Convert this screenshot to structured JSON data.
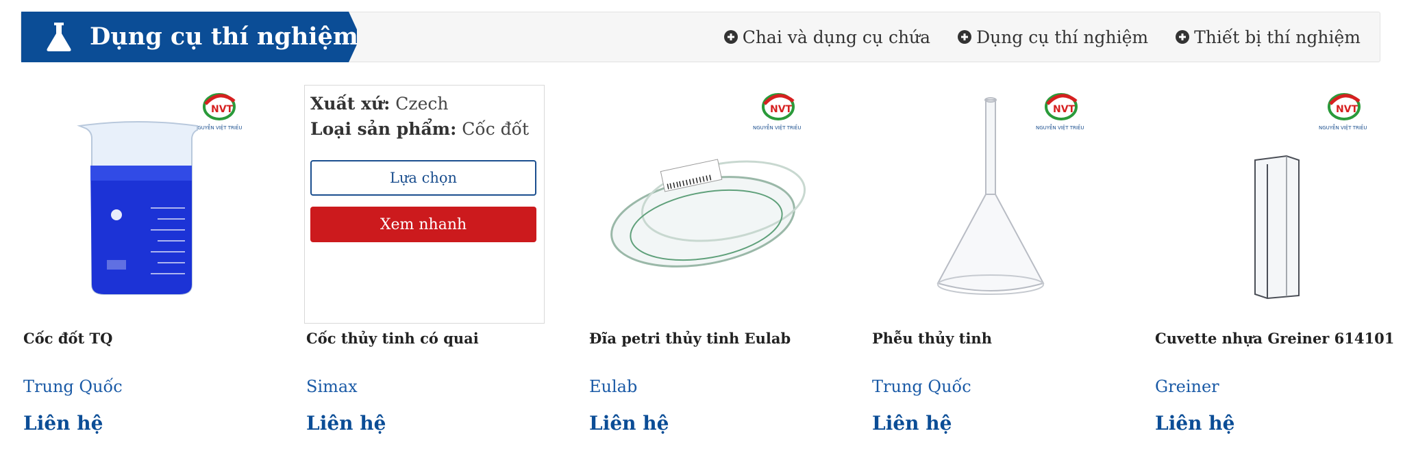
{
  "category": {
    "title": "Dụng cụ thí nghiệm",
    "links": [
      {
        "label": "Chai và dụng cụ chứa",
        "icon": "plus-circle-icon"
      },
      {
        "label": "Dụng cụ thí nghiệm",
        "icon": "plus-circle-icon"
      },
      {
        "label": "Thiết bị thí nghiệm",
        "icon": "plus-circle-icon"
      }
    ]
  },
  "logo": {
    "mark": "NVT",
    "text": "NGUYỄN VIỆT TRIỀU"
  },
  "products": [
    {
      "name": "Cốc đốt TQ",
      "brand": "Trung Quốc",
      "price": "Liên hệ",
      "image": "blue-beaker"
    },
    {
      "name": "Cốc thủy tinh có quai",
      "brand": "Simax",
      "price": "Liên hệ",
      "image": "hover-panel"
    },
    {
      "name": "Đĩa petri thủy tinh Eulab",
      "brand": "Eulab",
      "price": "Liên hệ",
      "image": "petri-dish"
    },
    {
      "name": "Phễu thủy tinh",
      "brand": "Trung Quốc",
      "price": "Liên hệ",
      "image": "glass-funnel"
    },
    {
      "name": "Cuvette nhựa Greiner 614101",
      "brand": "Greiner",
      "price": "Liên hệ",
      "image": "cuvette"
    }
  ],
  "hover": {
    "origin_label": "Xuất xứ:",
    "origin_value": "Czech",
    "type_label": "Loại sản phẩm:",
    "type_value": "Cốc đốt",
    "select_button": "Lựa chọn",
    "quickview_button": "Xem nhanh"
  },
  "colors": {
    "primary": "#0b4d96",
    "accent_red": "#cc1a1d",
    "link": "#1a5aa6"
  }
}
